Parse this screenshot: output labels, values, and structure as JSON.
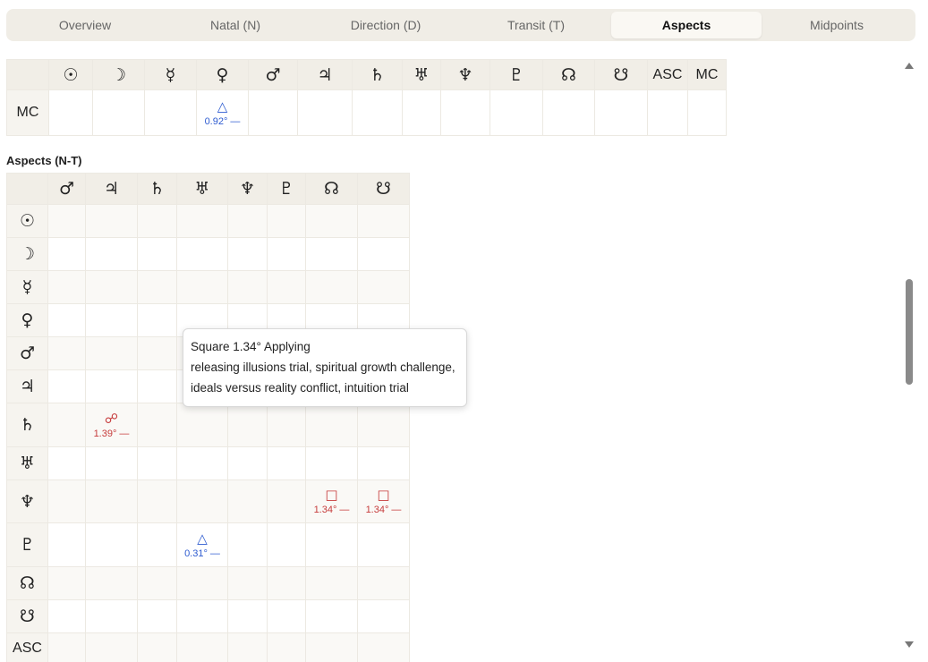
{
  "tabs": [
    {
      "label": "Overview",
      "active": false
    },
    {
      "label": "Natal (N)",
      "active": false
    },
    {
      "label": "Direction (D)",
      "active": false
    },
    {
      "label": "Transit (T)",
      "active": false
    },
    {
      "label": "Aspects",
      "active": true
    },
    {
      "label": "Midpoints",
      "active": false
    }
  ],
  "top_table": {
    "columns": [
      "☉",
      "☽",
      "☿",
      "♀",
      "♂",
      "♃",
      "♄",
      "♅",
      "♆",
      "♇",
      "☊",
      "☋",
      "ASC",
      "MC"
    ],
    "row_label": "MC",
    "cells": [
      {
        "col": 3,
        "symbol": "△",
        "orb": "0.92° —",
        "color": "blue"
      }
    ]
  },
  "section_title": "Aspects (N-T)",
  "nt_table": {
    "columns": [
      "♂",
      "♃",
      "♄",
      "♅",
      "♆",
      "♇",
      "☊",
      "☋"
    ],
    "rows": [
      "☉",
      "☽",
      "☿",
      "♀",
      "♂",
      "♃",
      "♄",
      "♅",
      "♆",
      "♇",
      "☊",
      "☋",
      "ASC"
    ],
    "cells": [
      {
        "row": 6,
        "col": 1,
        "symbol": "☍",
        "orb": "1.39° —",
        "color": "red"
      },
      {
        "row": 8,
        "col": 6,
        "symbol": "□",
        "orb": "1.34° —",
        "color": "red"
      },
      {
        "row": 8,
        "col": 7,
        "symbol": "□",
        "orb": "1.34° —",
        "color": "red"
      },
      {
        "row": 9,
        "col": 3,
        "symbol": "△",
        "orb": "0.31° —",
        "color": "blue"
      }
    ]
  },
  "tooltip": {
    "title": "Square 1.34° Applying",
    "body": "releasing illusions trial, spiritual growth challenge, ideals versus reality conflict, intuition trial"
  },
  "colors": {
    "blue": "#2d5bd0",
    "red": "#c63b3b",
    "header_bg": "#f1eee7"
  }
}
